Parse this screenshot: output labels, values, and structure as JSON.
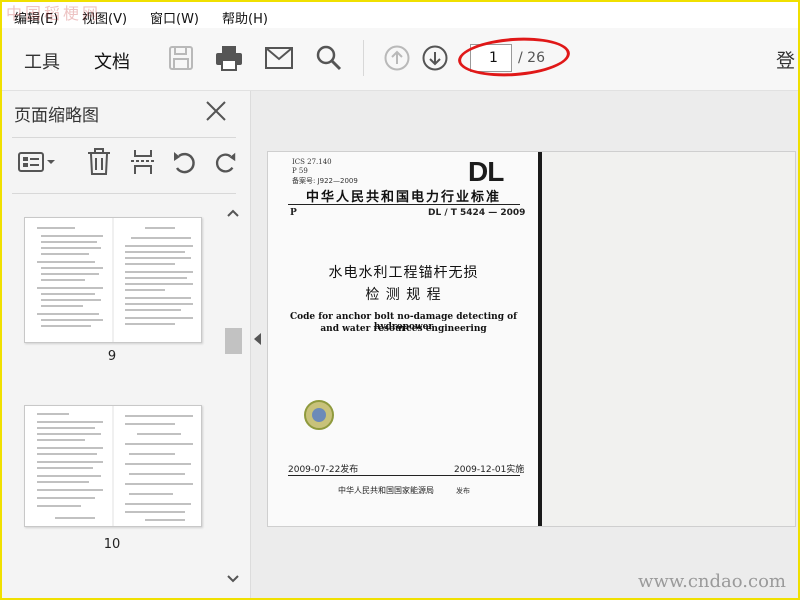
{
  "watermarks": {
    "top_left": "中国稻梗网",
    "bottom_right": "www.cndao.com"
  },
  "menu": [
    {
      "label": "编辑(E)"
    },
    {
      "label": "视图(V)"
    },
    {
      "label": "窗口(W)"
    },
    {
      "label": "帮助(H)"
    }
  ],
  "toolbar": {
    "tabs": [
      {
        "label": "工具"
      },
      {
        "label": "文档",
        "active": true
      }
    ],
    "tools": [
      "save-icon",
      "print-icon",
      "mail-icon",
      "search-icon",
      "prev-page-icon",
      "next-page-icon"
    ],
    "page_current": "1",
    "page_total": "/ 26",
    "login": "登"
  },
  "panel": {
    "title": "页面缩略图",
    "tools": [
      "thumbnail-options-icon",
      "delete-icon",
      "extract-icon",
      "rotate-ccw-icon",
      "rotate-cw-icon"
    ],
    "thumbnails": [
      {
        "page": "9"
      },
      {
        "page": "10"
      }
    ]
  },
  "document": {
    "ics": "ICS 27.140",
    "p59": "P 59",
    "record": "备案号: J922—2009",
    "mark": "DL",
    "standard_title": "中华人民共和国电力行业标准",
    "code_prefix": "P",
    "code_number": "DL / T 5424 — 2009",
    "title_cn_1": "水电水利工程锚杆无损",
    "title_cn_2": "检  测  规  程",
    "title_en_1": "Code for anchor bolt no-damage detecting of hydropower",
    "title_en_2": "and water resources engineering",
    "publish_date": "2009-07-22发布",
    "effective_date": "2009-12-01实施",
    "issuer": "中华人民共和国国家能源局",
    "issuer_tag": "发布"
  },
  "colors": {
    "frame": "#f0e000",
    "highlight_circle": "#e01818"
  }
}
